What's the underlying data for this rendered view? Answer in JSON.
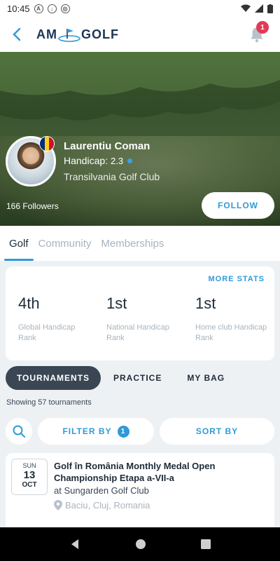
{
  "status_bar": {
    "time": "10:45",
    "icons": [
      "a-icon",
      "save-data-icon",
      "data-saver-icon"
    ]
  },
  "header": {
    "logo_left": "AM",
    "logo_right": "GOLF",
    "notification_count": "1"
  },
  "profile": {
    "name": "Laurentiu Coman",
    "handicap_label": "Handicap:",
    "handicap_value": "2.3",
    "club": "Transilvania Golf Club",
    "followers": "166 Followers",
    "follow_label": "FOLLOW",
    "flag_colors": [
      "#002b7f",
      "#fcd116",
      "#ce1126"
    ]
  },
  "tabs": [
    {
      "label": "Golf",
      "active": true
    },
    {
      "label": "Community",
      "active": false
    },
    {
      "label": "Memberships",
      "active": false
    }
  ],
  "stats": {
    "more_label": "MORE STATS",
    "items": [
      {
        "value": "4th",
        "label": "Global Handicap Rank"
      },
      {
        "value": "1st",
        "label": "National Handicap Rank"
      },
      {
        "value": "1st",
        "label": "Home club Handicap Rank"
      }
    ]
  },
  "segments": [
    {
      "label": "TOURNAMENTS",
      "active": true
    },
    {
      "label": "PRACTICE",
      "active": false
    },
    {
      "label": "MY BAG",
      "active": false
    }
  ],
  "showing_text": "Showing 57 tournaments",
  "tools": {
    "filter_label": "FILTER BY",
    "filter_count": "1",
    "sort_label": "SORT BY"
  },
  "tournament": {
    "dow": "SUN",
    "day": "13",
    "month": "OCT",
    "title": "Golf în România Monthly Medal Open Championship Etapa a-VII-a",
    "venue": "at Sungarden Golf Club",
    "location": "Baciu, Cluj, Romania"
  },
  "colors": {
    "accent": "#2f9ad6",
    "dark": "#3a4654",
    "badge": "#e23a56"
  }
}
